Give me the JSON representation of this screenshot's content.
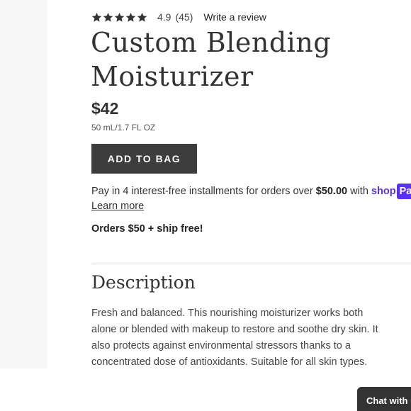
{
  "rating": {
    "stars": 5,
    "value": "4.9",
    "count": "(45)",
    "write_review_label": "Write a review",
    "star_color": "#333333"
  },
  "product": {
    "title": "Custom Blending Moisturizer",
    "price": "$42",
    "size": "50 mL/1.7 FL OZ"
  },
  "actions": {
    "add_to_bag_label": "ADD TO BAG"
  },
  "payment": {
    "installments_prefix": "Pay in 4 interest-free installments for orders over ",
    "installments_amount": "$50.00",
    "installments_suffix": " with ",
    "provider_logo_text": "shop",
    "provider_logo_box": "Pay",
    "provider_color": "#5a31f4",
    "learn_more_label": "Learn more"
  },
  "shipping": {
    "promo": "Orders $50 + ship free!"
  },
  "description": {
    "heading": "Description",
    "body": "Fresh and balanced. This nourishing moisturizer works both alone or blended with makeup to restore and soothe dry skin. It also protects against environmental stressors thanks to a concentrated dose of antioxidants. Suitable for all skin types."
  },
  "chat": {
    "label": "Chat with us"
  }
}
